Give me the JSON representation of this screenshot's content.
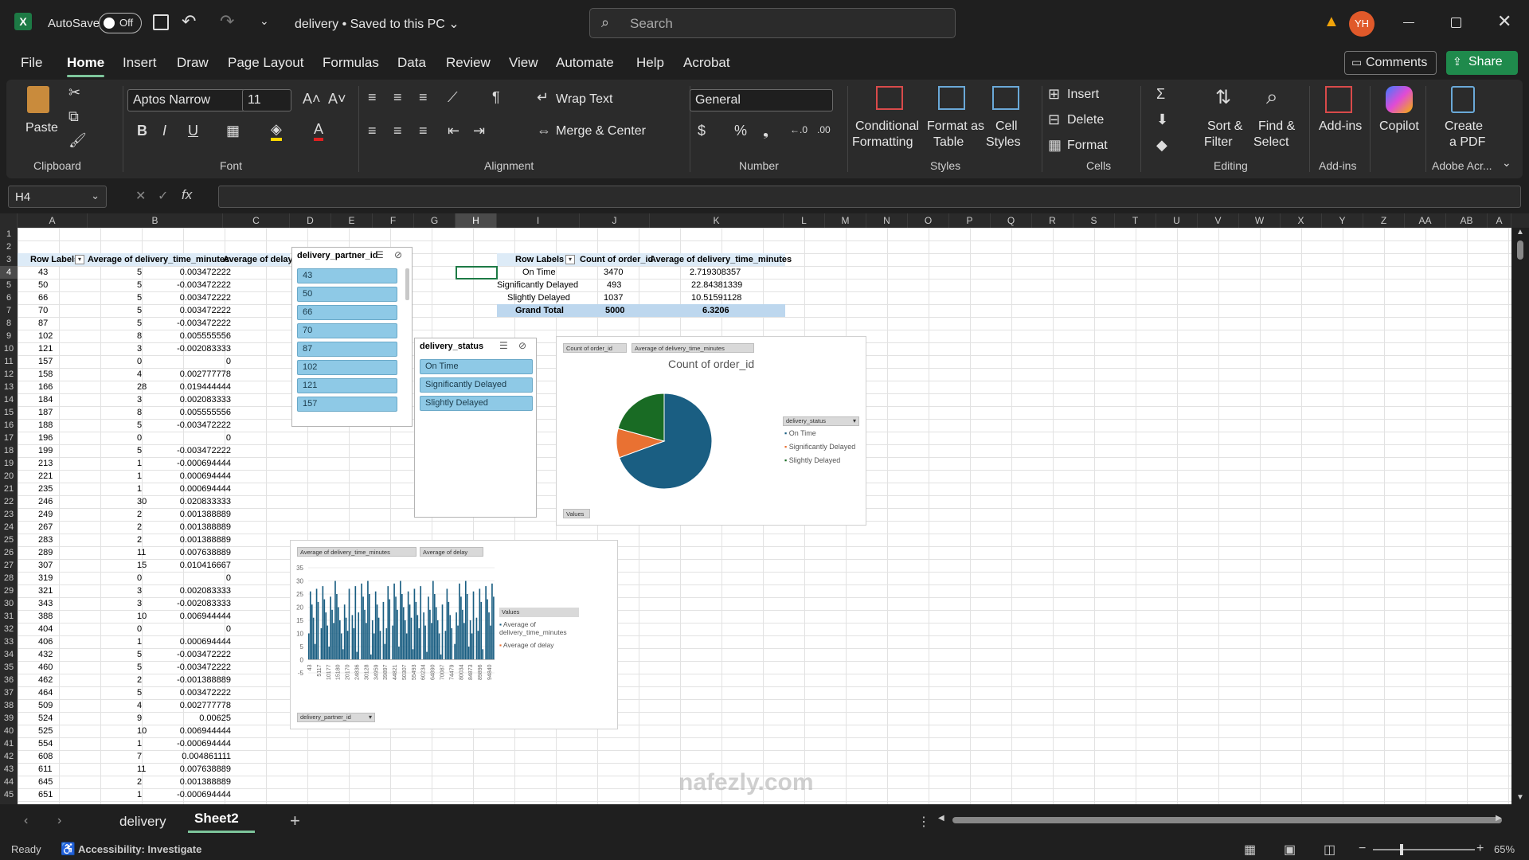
{
  "titlebar": {
    "autosave_label": "AutoSave",
    "autosave_state": "Off",
    "doc_title": "delivery • Saved to this PC ⌄",
    "search_placeholder": "Search",
    "user_initials": "YH"
  },
  "menu": [
    "File",
    "Home",
    "Insert",
    "Draw",
    "Page Layout",
    "Formulas",
    "Data",
    "Review",
    "View",
    "Automate",
    "Help",
    "Acrobat"
  ],
  "menu_right": {
    "comments": "Comments",
    "share": "Share"
  },
  "ribbon": {
    "clipboard": {
      "paste": "Paste",
      "label": "Clipboard"
    },
    "font": {
      "name": "Aptos Narrow",
      "size": "11",
      "label": "Font"
    },
    "alignment": {
      "wrap": "Wrap Text",
      "merge": "Merge & Center",
      "label": "Alignment"
    },
    "number": {
      "format": "General",
      "label": "Number"
    },
    "styles": {
      "cond1": "Conditional",
      "cond2": "Formatting",
      "fmt1": "Format as",
      "fmt2": "Table",
      "cell1": "Cell",
      "cell2": "Styles",
      "label": "Styles"
    },
    "cells": {
      "insert": "Insert",
      "delete": "Delete",
      "format": "Format",
      "label": "Cells"
    },
    "editing": {
      "sort1": "Sort &",
      "sort2": "Filter",
      "find1": "Find &",
      "find2": "Select",
      "label": "Editing"
    },
    "addins": {
      "name": "Add-ins",
      "label": "Add-ins"
    },
    "copilot": {
      "name": "Copilot"
    },
    "acrobat": {
      "create1": "Create",
      "create2": "a PDF",
      "label": "Adobe Acr..."
    }
  },
  "formula": {
    "namebox": "H4",
    "fx": "fx",
    "content": ""
  },
  "columns": [
    "A",
    "B",
    "C",
    "D",
    "E",
    "F",
    "G",
    "H",
    "I",
    "J",
    "K",
    "L",
    "M",
    "N",
    "O",
    "P",
    "Q",
    "R",
    "S",
    "T",
    "U",
    "V",
    "W",
    "X",
    "Y",
    "Z",
    "AA",
    "AB",
    "A"
  ],
  "pivot1": {
    "headers": [
      "Row Labels",
      "Average of delivery_time_minutes",
      "Average of delay"
    ],
    "rows": [
      [
        "43",
        "5",
        "0.003472222"
      ],
      [
        "50",
        "5",
        "-0.003472222"
      ],
      [
        "66",
        "5",
        "0.003472222"
      ],
      [
        "70",
        "5",
        "0.003472222"
      ],
      [
        "87",
        "5",
        "-0.003472222"
      ],
      [
        "102",
        "8",
        "0.005555556"
      ],
      [
        "121",
        "3",
        "-0.002083333"
      ],
      [
        "157",
        "0",
        "0"
      ],
      [
        "158",
        "4",
        "0.002777778"
      ],
      [
        "166",
        "28",
        "0.019444444"
      ],
      [
        "184",
        "3",
        "0.002083333"
      ],
      [
        "187",
        "8",
        "0.005555556"
      ],
      [
        "188",
        "5",
        "-0.003472222"
      ],
      [
        "196",
        "0",
        "0"
      ],
      [
        "199",
        "5",
        "-0.003472222"
      ],
      [
        "213",
        "1",
        "-0.000694444"
      ],
      [
        "221",
        "1",
        "0.000694444"
      ],
      [
        "235",
        "1",
        "0.000694444"
      ],
      [
        "246",
        "30",
        "0.020833333"
      ],
      [
        "249",
        "2",
        "0.001388889"
      ],
      [
        "267",
        "2",
        "0.001388889"
      ],
      [
        "283",
        "2",
        "0.001388889"
      ],
      [
        "289",
        "11",
        "0.007638889"
      ],
      [
        "307",
        "15",
        "0.010416667"
      ],
      [
        "319",
        "0",
        "0"
      ],
      [
        "321",
        "3",
        "0.002083333"
      ],
      [
        "343",
        "3",
        "-0.002083333"
      ],
      [
        "388",
        "10",
        "0.006944444"
      ],
      [
        "404",
        "0",
        "0"
      ],
      [
        "406",
        "1",
        "0.000694444"
      ],
      [
        "432",
        "5",
        "-0.003472222"
      ],
      [
        "460",
        "5",
        "-0.003472222"
      ],
      [
        "462",
        "2",
        "-0.001388889"
      ],
      [
        "464",
        "5",
        "0.003472222"
      ],
      [
        "509",
        "4",
        "0.002777778"
      ],
      [
        "524",
        "9",
        "0.00625"
      ],
      [
        "525",
        "10",
        "0.006944444"
      ],
      [
        "554",
        "1",
        "-0.000694444"
      ],
      [
        "608",
        "7",
        "0.004861111"
      ],
      [
        "611",
        "11",
        "0.007638889"
      ],
      [
        "645",
        "2",
        "0.001388889"
      ],
      [
        "651",
        "1",
        "-0.000694444"
      ]
    ]
  },
  "pivot2": {
    "headers": [
      "Row Labels",
      "Count of order_id",
      "Average of delivery_time_minutes"
    ],
    "rows": [
      [
        "On Time",
        "3470",
        "2.719308357"
      ],
      [
        "Significantly Delayed",
        "493",
        "22.84381339"
      ],
      [
        "Slightly Delayed",
        "1037",
        "10.51591128"
      ]
    ],
    "total": [
      "Grand Total",
      "5000",
      "6.3206"
    ]
  },
  "slicer1": {
    "title": "delivery_partner_id",
    "items": [
      "43",
      "50",
      "66",
      "70",
      "87",
      "102",
      "121",
      "157"
    ]
  },
  "slicer2": {
    "title": "delivery_status",
    "items": [
      "On Time",
      "Significantly Delayed",
      "Slightly Delayed"
    ]
  },
  "pie": {
    "field1": "Count of order_id",
    "field2": "Average of delivery_time_minutes",
    "title": "Count of order_id",
    "legend_field": "delivery_status",
    "values_btn": "Values"
  },
  "bar": {
    "field1": "Average of delivery_time_minutes",
    "field2": "Average of delay",
    "legend_title": "Values",
    "legend1": "Average of delivery_time_minutes",
    "legend2": "Average of delay",
    "axis_field": "delivery_partner_id"
  },
  "chart_data": [
    {
      "type": "pie",
      "title": "Count of order_id",
      "categories": [
        "On Time",
        "Significantly Delayed",
        "Slightly Delayed"
      ],
      "values": [
        3470,
        493,
        1037
      ],
      "colors": [
        "#1a5e82",
        "#e97132",
        "#196b24"
      ]
    },
    {
      "type": "bar",
      "xlabel": "",
      "ylabel": "",
      "ylim": [
        -5,
        35
      ],
      "yticks": [
        "35",
        "30",
        "25",
        "20",
        "15",
        "10",
        "5",
        "0",
        "-5"
      ],
      "categories": [
        "43",
        "5117",
        "10177",
        "15180",
        "20170",
        "24836",
        "30128",
        "34959",
        "39897",
        "44821",
        "50307",
        "55493",
        "60234",
        "64890",
        "70087",
        "74479",
        "80034",
        "84873",
        "89896",
        "94840"
      ],
      "series": [
        {
          "name": "Average of delivery_time_minutes",
          "values": [
            5,
            5,
            5,
            5,
            5,
            8,
            3,
            0,
            4,
            28,
            3,
            8,
            5,
            0,
            5,
            1,
            1,
            1,
            30,
            2
          ]
        },
        {
          "name": "Average of delay",
          "values": [
            0,
            0,
            0,
            0,
            0,
            0,
            0,
            0,
            0,
            0,
            0,
            0,
            0,
            0,
            0,
            0,
            0,
            0,
            0,
            0
          ]
        }
      ]
    }
  ],
  "sheets": {
    "tab1": "delivery",
    "tab2": "Sheet2"
  },
  "status": {
    "ready": "Ready",
    "accessibility": "Accessibility: Investigate",
    "zoom": "65%"
  },
  "watermark": {
    "brand": "nafezly.com"
  }
}
